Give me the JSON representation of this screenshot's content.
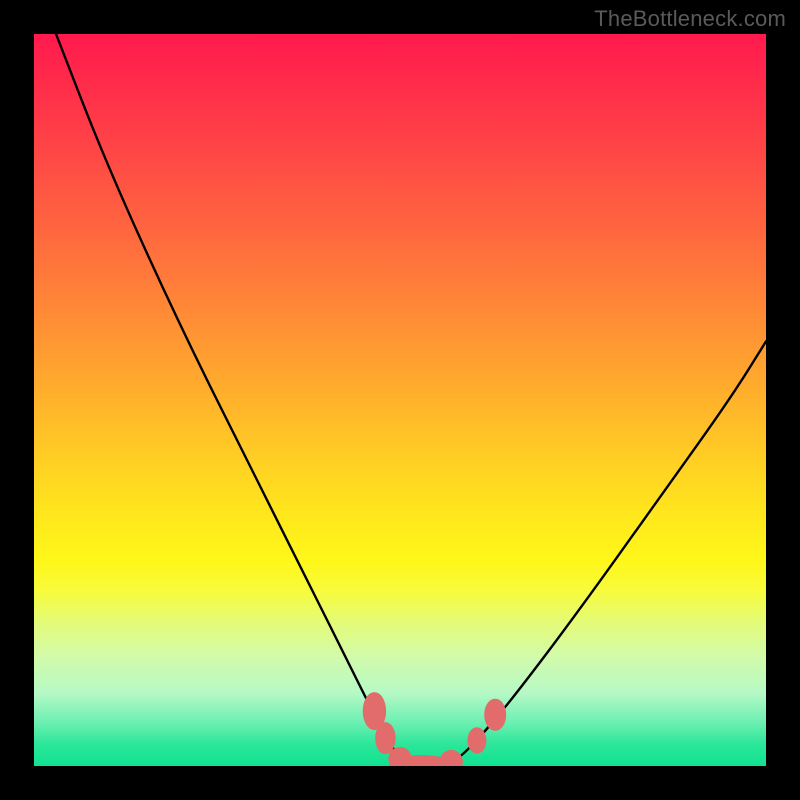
{
  "watermark": "TheBottleneck.com",
  "chart_data": {
    "type": "line",
    "title": "",
    "xlabel": "",
    "ylabel": "",
    "xlim": [
      0,
      100
    ],
    "ylim": [
      0,
      100
    ],
    "grid": false,
    "legend": false,
    "series": [
      {
        "name": "bottleneck-curve",
        "x": [
          3,
          10,
          20,
          30,
          38,
          43,
          46,
          48,
          50,
          52,
          54,
          56,
          58,
          61,
          66,
          75,
          85,
          95,
          100
        ],
        "y": [
          100,
          82,
          60,
          40,
          24,
          14,
          8,
          4,
          1,
          0,
          0,
          0,
          1,
          4,
          10,
          22,
          36,
          50,
          58
        ]
      }
    ],
    "markers": {
      "name": "highlight-points",
      "color": "#e26b6b",
      "points": [
        {
          "x": 46.5,
          "y": 7.5,
          "rx": 1.6,
          "ry": 2.6
        },
        {
          "x": 48.0,
          "y": 3.8,
          "rx": 1.4,
          "ry": 2.2
        },
        {
          "x": 50.0,
          "y": 1.0,
          "rx": 1.6,
          "ry": 1.6
        },
        {
          "x": 53.0,
          "y": 0.0,
          "rx": 4.5,
          "ry": 1.5
        },
        {
          "x": 57.0,
          "y": 0.6,
          "rx": 1.6,
          "ry": 1.6
        },
        {
          "x": 60.5,
          "y": 3.5,
          "rx": 1.3,
          "ry": 1.8
        },
        {
          "x": 63.0,
          "y": 7.0,
          "rx": 1.5,
          "ry": 2.2
        }
      ]
    },
    "background_gradient": {
      "top": "#ff1a4d",
      "mid": "#ffce24",
      "bottom": "#0fe291"
    }
  }
}
